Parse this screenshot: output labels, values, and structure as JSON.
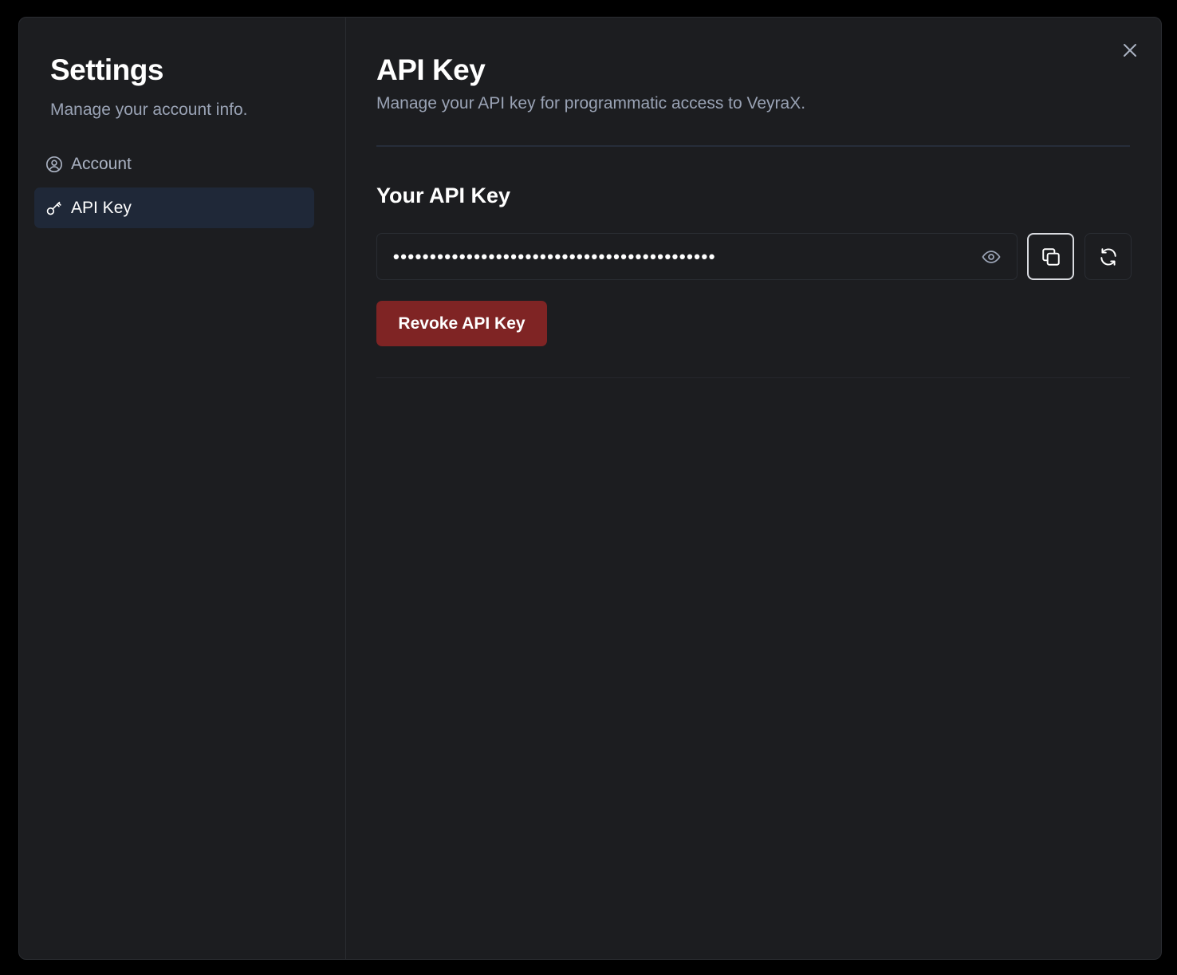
{
  "sidebar": {
    "title": "Settings",
    "subtitle": "Manage your account info.",
    "items": [
      {
        "label": "Account",
        "icon": "user-circle-icon",
        "active": false
      },
      {
        "label": "API Key",
        "icon": "key-icon",
        "active": true
      }
    ]
  },
  "main": {
    "title": "API Key",
    "subtitle": "Manage your API key for programmatic access to VeyraX.",
    "section_title": "Your API Key",
    "api_key_masked": "••••••••••••••••••••••••••••••••••••••••••••",
    "revoke_label": "Revoke API Key"
  },
  "colors": {
    "background": "#1c1d20",
    "active_nav": "#1f2838",
    "revoke": "#7f2424",
    "muted_text": "#9aa3b5"
  }
}
